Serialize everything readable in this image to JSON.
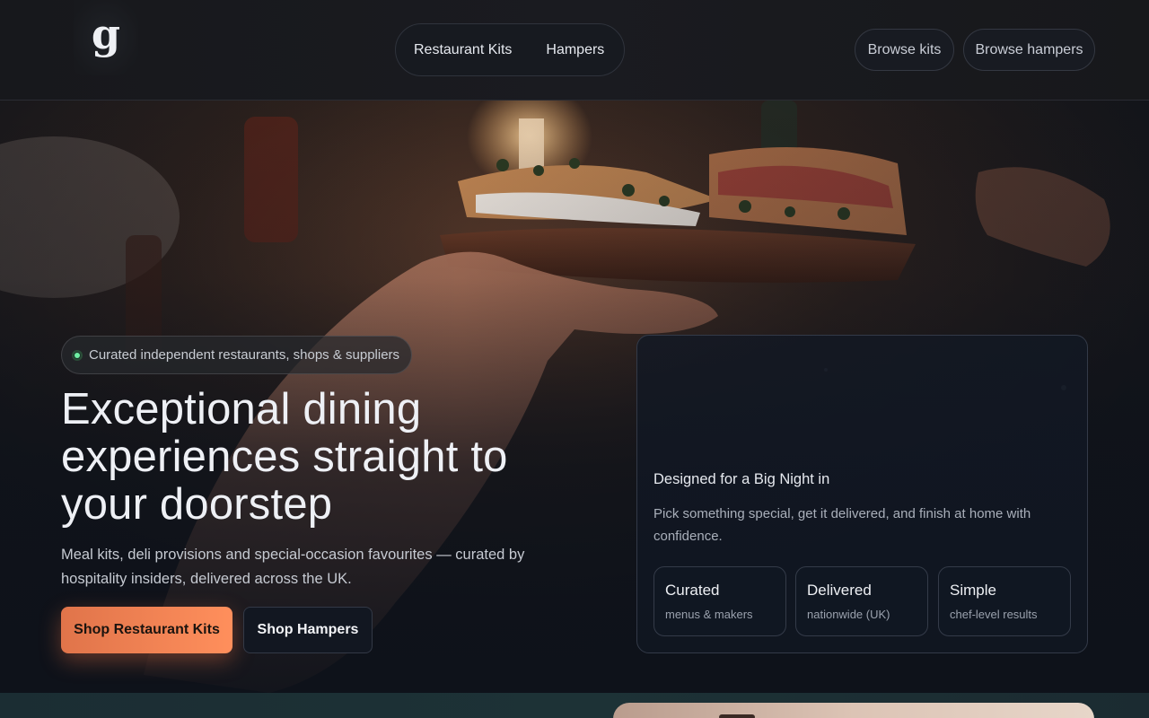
{
  "brand": {
    "logo_letter": "g"
  },
  "nav": {
    "items": [
      {
        "label": "Restaurant Kits"
      },
      {
        "label": "Hampers"
      }
    ]
  },
  "header_actions": {
    "browse_kits": "Browse kits",
    "browse_hampers": "Browse hampers"
  },
  "hero": {
    "badge": "Curated independent restaurants, shops & suppliers",
    "title": "Exceptional dining experiences straight to your doorstep",
    "subtitle": "Meal kits, deli provisions and special-occasion favourites — curated by hospitality insiders, delivered across the UK.",
    "primary_cta": "Shop Restaurant Kits",
    "secondary_cta": "Shop Hampers",
    "photo_icon": "dinner-table-photo"
  },
  "card": {
    "title": "Designed for a Big Night in",
    "body": "Pick something special, get it delivered, and finish at home with confidence.",
    "stats": [
      {
        "title": "Curated",
        "sub": "menus & makers"
      },
      {
        "title": "Delivered",
        "sub": "nationwide (UK)"
      },
      {
        "title": "Simple",
        "sub": "chef-level results"
      }
    ]
  },
  "colors": {
    "accent": "#ff8f5c",
    "accent_dark": "#e0744a",
    "status_dot": "#6ff0a3",
    "background": "#14161b"
  }
}
